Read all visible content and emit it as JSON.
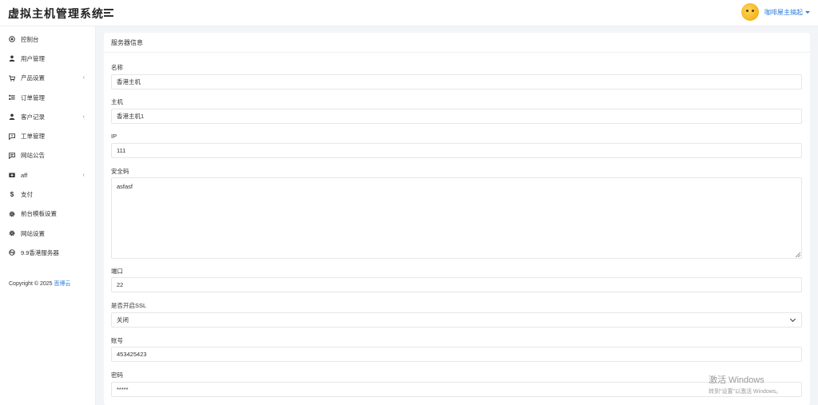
{
  "app": {
    "logo_text": "虚拟主机管理系统"
  },
  "header": {
    "username": "咖啡屋主搞起"
  },
  "sidebar": {
    "items": [
      {
        "label": "控制台",
        "icon": "dashboard-icon",
        "has_submenu": false
      },
      {
        "label": "用户管理",
        "icon": "user-icon",
        "has_submenu": false
      },
      {
        "label": "产品设置",
        "icon": "cart-icon",
        "has_submenu": true
      },
      {
        "label": "订单管理",
        "icon": "list-icon",
        "has_submenu": false
      },
      {
        "label": "客户记录",
        "icon": "user-icon",
        "has_submenu": true
      },
      {
        "label": "工单管理",
        "icon": "ticket-icon",
        "has_submenu": false
      },
      {
        "label": "网站公告",
        "icon": "announcement-icon",
        "has_submenu": false
      },
      {
        "label": "aff",
        "icon": "affiliate-icon",
        "has_submenu": true
      },
      {
        "label": "支付",
        "icon": "dollar-icon",
        "has_submenu": false
      },
      {
        "label": "前台模板设置",
        "icon": "gear-icon",
        "has_submenu": false
      },
      {
        "label": "网站设置",
        "icon": "gear-icon",
        "has_submenu": false
      },
      {
        "label": "9.9香港服务器",
        "icon": "server-icon",
        "has_submenu": false
      }
    ],
    "copyright_prefix": "Copyright © 2025",
    "copyright_link": "悲博云"
  },
  "card": {
    "title": "服务器信息",
    "fields": {
      "name": {
        "label": "名称",
        "value": "香港主机"
      },
      "host": {
        "label": "主机",
        "value": "香港主机1"
      },
      "ip": {
        "label": "IP",
        "value": "111"
      },
      "security_code": {
        "label": "安全码",
        "value": "asfasf"
      },
      "port": {
        "label": "端口",
        "value": "22"
      },
      "ssl": {
        "label": "是否开启SSL",
        "value": "关闭"
      },
      "account": {
        "label": "账号",
        "value": "453425423"
      },
      "password": {
        "label": "密码",
        "value": "*****"
      }
    }
  },
  "watermark": {
    "line1": "激活 Windows",
    "line2": "转到\"设置\"以激活 Windows。"
  }
}
